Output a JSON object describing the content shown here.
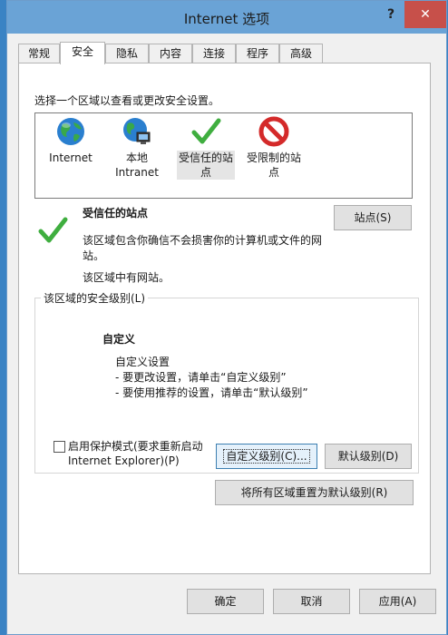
{
  "window": {
    "title": "Internet 选项",
    "help": "?",
    "close": "✕"
  },
  "tabs": [
    {
      "label": "常规"
    },
    {
      "label": "安全"
    },
    {
      "label": "隐私"
    },
    {
      "label": "内容"
    },
    {
      "label": "连接"
    },
    {
      "label": "程序"
    },
    {
      "label": "高级"
    }
  ],
  "security": {
    "prompt": "选择一个区域以查看或更改安全设置。",
    "zones": [
      {
        "line1": "Internet",
        "line2": "",
        "icon": "globe-icon"
      },
      {
        "line1": "本地",
        "line2": "Intranet",
        "icon": "intranet-globe-icon"
      },
      {
        "line1": "受信任的站",
        "line2": "点",
        "icon": "green-checkmark-icon"
      },
      {
        "line1": "受限制的站",
        "line2": "点",
        "icon": "restricted-icon"
      }
    ],
    "selected_zone": {
      "name": "受信任的站点",
      "desc_line1": "该区域包含你确信不会损害你的计算机或文件的网",
      "desc_line2": "站。",
      "sites_note": "该区域中有网站。"
    },
    "sites_button": "站点(S)",
    "level_group": {
      "title": "该区域的安全级别(L)",
      "level_name": "自定义",
      "level_desc": "自定义设置",
      "bullet1": "- 要更改设置，请单击“自定义级别”",
      "bullet2": "- 要使用推荐的设置，请单击“默认级别”",
      "protected_mode_line1": "启用保护模式(要求重新启动",
      "protected_mode_line2": "Internet Explorer)(P)",
      "protected_mode_checked": false,
      "custom_level_button": "自定义级别(C)...",
      "default_level_button": "默认级别(D)"
    },
    "reset_all_button": "将所有区域重置为默认级别(R)"
  },
  "footer": {
    "ok": "确定",
    "cancel": "取消",
    "apply": "应用(A)"
  },
  "colors": {
    "titlebar": "#6aa3d6",
    "close": "#c7504a",
    "accent": "#3c7fb1"
  }
}
